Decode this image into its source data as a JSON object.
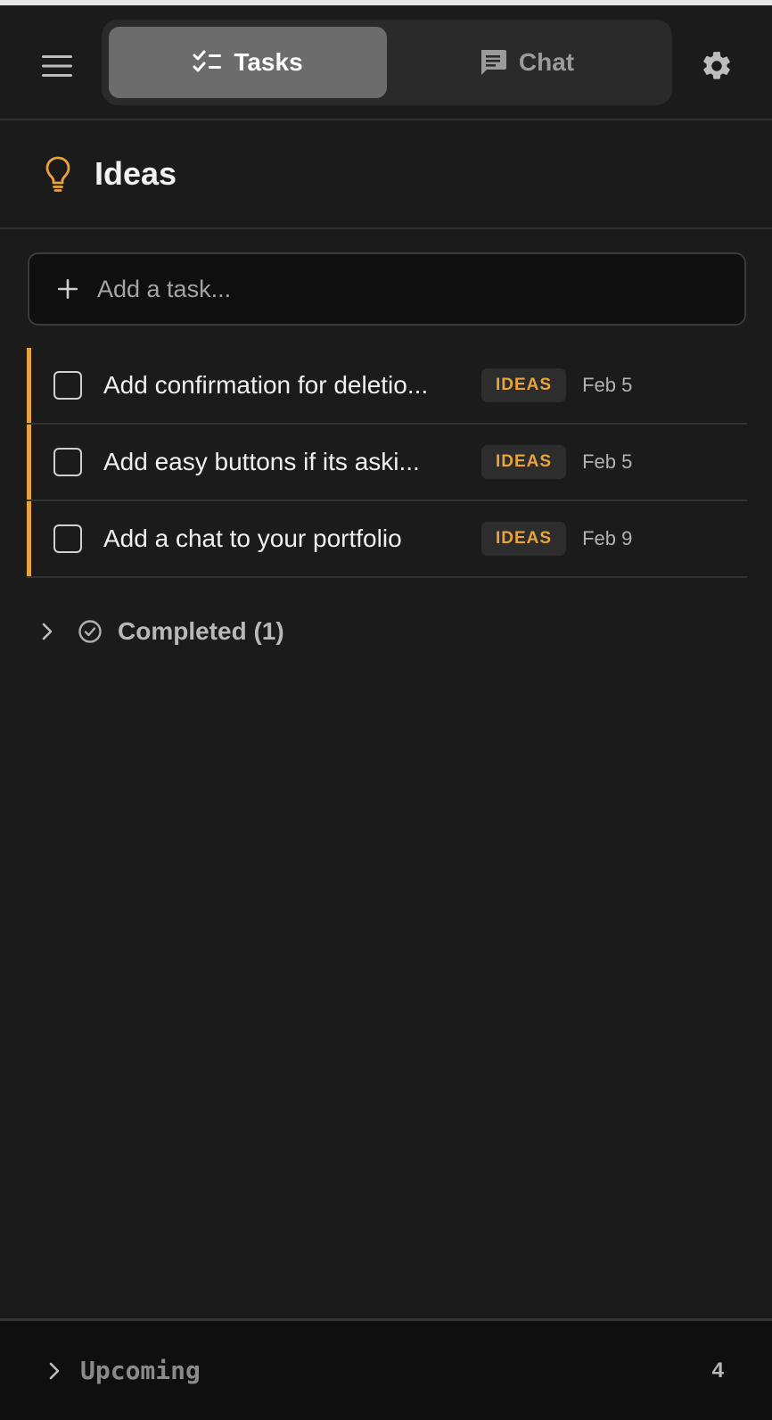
{
  "header": {
    "tabs": [
      {
        "label": "Tasks",
        "icon": "checklist-icon",
        "active": true
      },
      {
        "label": "Chat",
        "icon": "chat-bubble-icon",
        "active": false
      }
    ],
    "menu_icon": "hamburger-menu-icon",
    "settings_icon": "gear-icon"
  },
  "page": {
    "title": "Ideas",
    "icon": "lightbulb-icon",
    "accent_color": "#e8a33a"
  },
  "add_task": {
    "placeholder": "Add a task...",
    "value": ""
  },
  "tasks": [
    {
      "text": "Add confirmation for deletio...",
      "tag": "IDEAS",
      "date": "Feb 5"
    },
    {
      "text": "Add easy buttons if its aski...",
      "tag": "IDEAS",
      "date": "Feb 5"
    },
    {
      "text": "Add a chat to your portfolio",
      "tag": "IDEAS",
      "date": "Feb 9"
    }
  ],
  "completed": {
    "label": "Completed (1)"
  },
  "footer": {
    "label": "Upcoming",
    "count": "4"
  }
}
